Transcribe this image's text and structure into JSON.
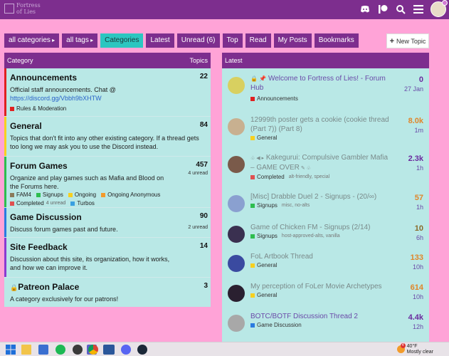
{
  "header": {
    "logo_text": "Fortress of Lies",
    "icons": [
      "discord-icon",
      "patreon-icon",
      "search-icon",
      "hamburger-menu-icon",
      "user-avatar"
    ]
  },
  "nav": {
    "all_categories": "all categories",
    "all_tags": "all tags",
    "categories": "Categories",
    "latest": "Latest",
    "unread": "Unread (6)",
    "top": "Top",
    "read": "Read",
    "my_posts": "My Posts",
    "bookmarks": "Bookmarks",
    "new_topic": "New Topic"
  },
  "categories_panel": {
    "header_category": "Category",
    "header_topics": "Topics",
    "items": [
      {
        "name": "Announcements",
        "color": "#e02020",
        "count": "22",
        "unread": "",
        "desc_line": "Official staff announcements. Chat @",
        "desc_link": "https://discord.gg/Vbbh9bXHTW",
        "subs": [
          {
            "name": "Rules & Moderation",
            "color": "#e02020",
            "unread": ""
          }
        ]
      },
      {
        "name": "General",
        "color": "#f7d020",
        "count": "84",
        "unread": "",
        "desc": "Topics that don't fit into any other existing category. If a thread gets too long we may ask you to use the Discord instead.",
        "subs": []
      },
      {
        "name": "Forum Games",
        "color": "#2ebd4f",
        "count": "457",
        "unread": "4 unread",
        "desc": "Organize and play games such as Mafia and Blood on the Forums here.",
        "subs": [
          {
            "name": "FAM4",
            "color": "#8a7a5a",
            "unread": ""
          },
          {
            "name": "Signups",
            "color": "#2ebd4f",
            "unread": ""
          },
          {
            "name": "Ongoing",
            "color": "#f7d020",
            "unread": ""
          },
          {
            "name": "Ongoing Anonymous",
            "color": "#f39a2b",
            "unread": ""
          },
          {
            "name": "Completed",
            "color": "#e05050",
            "unread": "4 unread"
          },
          {
            "name": "Turbos",
            "color": "#3aa0e0",
            "unread": ""
          }
        ]
      },
      {
        "name": "Game Discussion",
        "color": "#2a7be0",
        "count": "90",
        "unread": "2 unread",
        "desc": "Discuss forum games past and future.",
        "subs": []
      },
      {
        "name": "Site Feedback",
        "color": "#8a3bd0",
        "count": "14",
        "unread": "",
        "desc": "Discussion about this site, its organization, how it works, and how we can improve it.",
        "subs": []
      },
      {
        "name": "Patreon Palace",
        "color": "#b9e8e6",
        "count": "3",
        "unread": "",
        "locked": true,
        "desc": "A category exclusively for our patrons!",
        "subs": []
      }
    ]
  },
  "latest_panel": {
    "header": "Latest",
    "topics": [
      {
        "title": "Welcome to Fortress of Lies! - Forum Hub",
        "prefix": "🔒 📌",
        "category": "Announcements",
        "cat_color": "#e02020",
        "tags": "",
        "replies": "0",
        "replies_color": "#6a2a9e",
        "time": "27 Jan",
        "unseen": true,
        "avatar": "#d8d060"
      },
      {
        "title": "12999th poster gets a cookie (cookie thread (Part 7)) (Part 8)",
        "prefix": "",
        "category": "General",
        "cat_color": "#f7d020",
        "tags": "",
        "replies": "8.0k",
        "replies_color": "#e0862b",
        "time": "1m",
        "unseen": false,
        "avatar": "#c8b090"
      },
      {
        "title": "Kakegurui: Compulsive Gambler Mafia – GAME OVER",
        "prefix": "♧ ◀ ▸",
        "suffix": " ✎ ♧",
        "category": "Completed",
        "cat_color": "#e05050",
        "tags": "alt-friendly, special",
        "replies": "2.3k",
        "replies_color": "#6a2a9e",
        "time": "1h",
        "unseen": false,
        "avatar": "#7a5a4a"
      },
      {
        "title": "[Misc] Drabble Duel 2 - Signups - (20/∞)",
        "prefix": "",
        "category": "Signups",
        "cat_color": "#2ebd4f",
        "tags": "misc, no-alts",
        "replies": "57",
        "replies_color": "#e0862b",
        "time": "1h",
        "unseen": false,
        "avatar": "#8aa0d0"
      },
      {
        "title": "Game of Chicken FM - Signups (2/14)",
        "prefix": "",
        "category": "Signups",
        "cat_color": "#2ebd4f",
        "tags": "host-approved-alts, vanilla",
        "replies": "10",
        "replies_color": "#8a6a2a",
        "time": "6h",
        "unseen": false,
        "avatar": "#3a3050"
      },
      {
        "title": "FoL Artbook Thread",
        "prefix": "",
        "category": "General",
        "cat_color": "#f7d020",
        "tags": "",
        "replies": "133",
        "replies_color": "#e0862b",
        "time": "10h",
        "unseen": false,
        "avatar": "#3a4aa0"
      },
      {
        "title": "My perception of FoLer Movie Archetypes",
        "prefix": "",
        "category": "General",
        "cat_color": "#f7d020",
        "tags": "",
        "replies": "614",
        "replies_color": "#e0862b",
        "time": "10h",
        "unseen": false,
        "avatar": "#2a2030"
      },
      {
        "title": "BOTC/BOTF Discussion Thread 2",
        "prefix": "",
        "category": "Game Discussion",
        "cat_color": "#2a7be0",
        "tags": "",
        "replies": "4.4k",
        "replies_color": "#6a2a9e",
        "time": "12h",
        "unseen": true,
        "avatar": "#a8a8a8"
      }
    ]
  },
  "taskbar": {
    "apps": [
      "windows-start-icon",
      "file-explorer-icon",
      "calendar-icon",
      "spotify-icon",
      "xbox-icon",
      "teams-icon",
      "chrome-icon",
      "word-icon",
      "discord-icon",
      "steam-icon"
    ],
    "weather_temp": "40°F",
    "weather_desc": "Mostly clear",
    "weather_badge": "4"
  }
}
